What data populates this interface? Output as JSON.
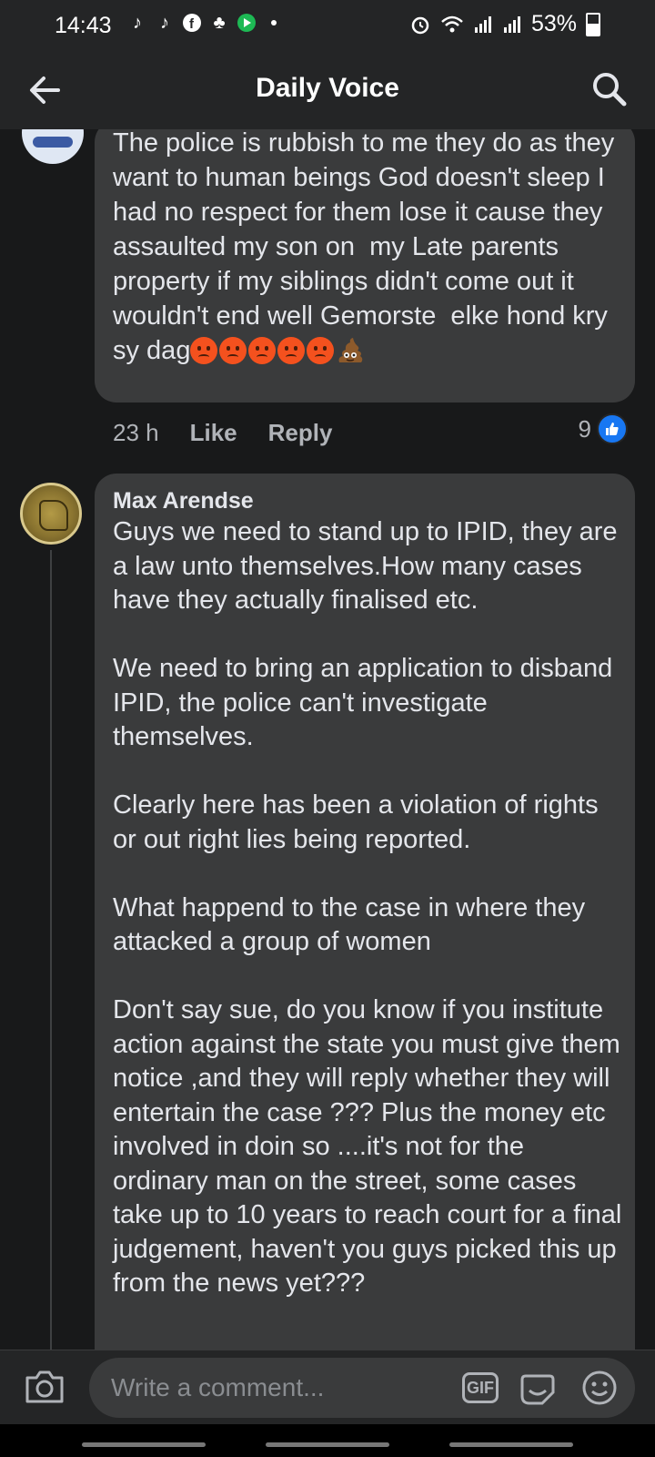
{
  "status_bar": {
    "time": "14:43",
    "battery": "53%",
    "battery_level": 0.53,
    "left_icons": [
      "tiktok-icon",
      "tiktok-icon",
      "facebook-icon",
      "app-icon",
      "play-icon",
      "dot-icon"
    ],
    "right_icons": [
      "alarm-icon",
      "wifi-icon",
      "signal-icon",
      "signal-icon",
      "battery-icon"
    ]
  },
  "header": {
    "title": "Daily Voice",
    "back_icon": "arrow-left-icon",
    "search_icon": "search-icon"
  },
  "comments": [
    {
      "text": "The police is rubbish to me they do as they want to human beings God doesn't sleep I had no respect for them lose it cause they assaulted my son on  my Late parents property if my siblings didn't come out it wouldn't end well Gemorste  elke hond kry sy dag",
      "emojis": [
        "angry-face-emoji",
        "angry-face-emoji",
        "angry-face-emoji",
        "angry-face-emoji",
        "angry-face-emoji",
        "pile-of-poo-emoji"
      ],
      "time": "23 h",
      "like_label": "Like",
      "reply_label": "Reply",
      "reaction_count": "9"
    },
    {
      "author": "Max Arendse",
      "text": "Guys we need to stand up to IPID, they are a law unto themselves.How many cases have they actually finalised etc.\n\nWe need to bring an application to disband IPID, the police can't investigate themselves.\n\nClearly here has been a violation of rights or out right lies being reported.\n\nWhat happend to the case in where they attacked a group of women\n\nDon't say sue, do you know if you institute action against the state you must give them notice ,and they will reply whether they will entertain the case ??? Plus the money etc involved in doin so ....it's not for the ordinary man on the street, some cases take up to 10 years to reach court for a final judgement, haven't you guys picked this up from the news yet???"
    }
  ],
  "composer": {
    "placeholder": "Write a comment...",
    "gif_label": "GIF"
  },
  "colors": {
    "background": "#18191a",
    "surface": "#242526",
    "bubble": "#3a3b3c",
    "accent": "#1877f2"
  }
}
